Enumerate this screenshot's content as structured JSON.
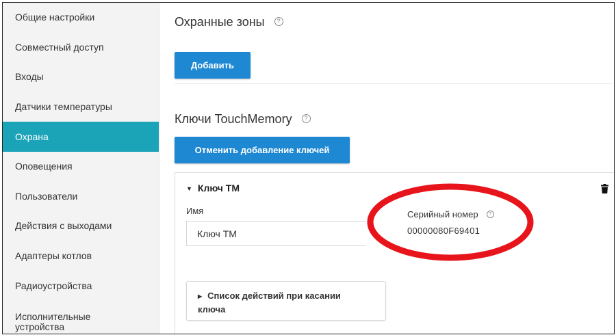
{
  "sidebar": {
    "items": [
      {
        "label": "Общие настройки",
        "active": false
      },
      {
        "label": "Совместный доступ",
        "active": false
      },
      {
        "label": "Входы",
        "active": false
      },
      {
        "label": "Датчики температуры",
        "active": false
      },
      {
        "label": "Охрана",
        "active": true
      },
      {
        "label": "Оповещения",
        "active": false
      },
      {
        "label": "Пользователи",
        "active": false
      },
      {
        "label": "Действия с выходами",
        "active": false
      },
      {
        "label": "Адаптеры котлов",
        "active": false
      },
      {
        "label": "Радиоустройства",
        "active": false
      },
      {
        "label": "Исполнительные устройства",
        "active": false
      }
    ]
  },
  "zones": {
    "title": "Охранные зоны",
    "help": "?",
    "add_button": "Добавить"
  },
  "keys": {
    "title": "Ключи TouchMemory",
    "help": "?",
    "cancel_button": "Отменить добавление ключей",
    "card": {
      "title": "Ключ ТМ",
      "name_label": "Имя",
      "name_value": "Ключ ТМ",
      "serial_label": "Серийный номер",
      "serial_help": "?",
      "serial_value": "00000080F69401",
      "actions_label": "Список действий при касании ключа"
    }
  },
  "colors": {
    "active_sidebar": "#1ba3b8",
    "button": "#1e88d2",
    "annotation": "#e8141c"
  }
}
